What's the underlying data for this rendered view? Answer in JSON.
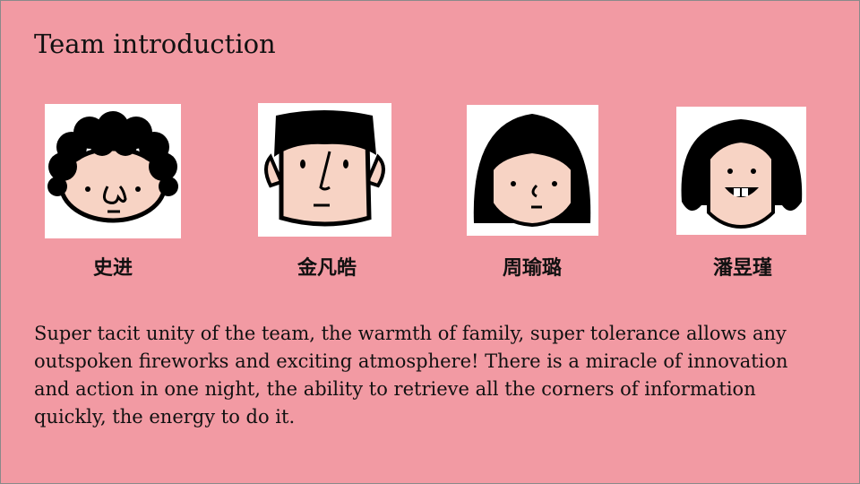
{
  "title": "Team introduction",
  "members": [
    {
      "name": "史进"
    },
    {
      "name": "金凡皓"
    },
    {
      "name": "周瑜璐"
    },
    {
      "name": "潘昱瑾"
    }
  ],
  "description": "Super tacit unity of the team, the warmth of family, super tolerance allows any outspoken fireworks and exciting atmosphere! There is a miracle of innovation and action in one night, the ability to retrieve all the corners of information quickly, the energy to do it.",
  "colors": {
    "background": "#f29aa3",
    "skin": "#f7d3c4",
    "hair": "#000000"
  }
}
